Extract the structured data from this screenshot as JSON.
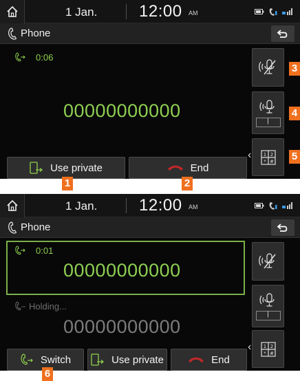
{
  "screen1": {
    "status": {
      "date": "1 Jan.",
      "time": "12:00",
      "ampm": "AM"
    },
    "title": "Phone",
    "call": {
      "duration": "0:06",
      "number": "00000000000"
    },
    "side_keys": {
      "mute_value": "ㅣ"
    },
    "buttons": {
      "use_private": "Use private",
      "end": "End"
    },
    "callouts": [
      "1",
      "2",
      "3",
      "4",
      "5"
    ]
  },
  "screen2": {
    "status": {
      "date": "1 Jan.",
      "time": "12:00",
      "ampm": "AM"
    },
    "title": "Phone",
    "active_call": {
      "duration": "0:01",
      "number": "00000000000"
    },
    "held_call": {
      "status": "Holding...",
      "number": "00000000000"
    },
    "side_keys": {
      "mute_value": "ㅣ"
    },
    "buttons": {
      "switch": "Switch",
      "use_private": "Use private",
      "end": "End"
    },
    "callouts": [
      "6"
    ]
  },
  "colors": {
    "accent_green": "#8ecf52",
    "end_red": "#c0282a",
    "callout_orange": "#f0701e"
  },
  "icons": [
    "home-icon",
    "battery-icon",
    "bluetooth-phone-icon",
    "signal-icon",
    "phone-handset-icon",
    "back-arrow-icon",
    "call-active-icon",
    "call-hold-icon",
    "mute-mic-icon",
    "mic-volume-icon",
    "keypad-icon",
    "chevron-left-icon",
    "transfer-phone-icon",
    "end-call-icon",
    "switch-call-icon"
  ]
}
